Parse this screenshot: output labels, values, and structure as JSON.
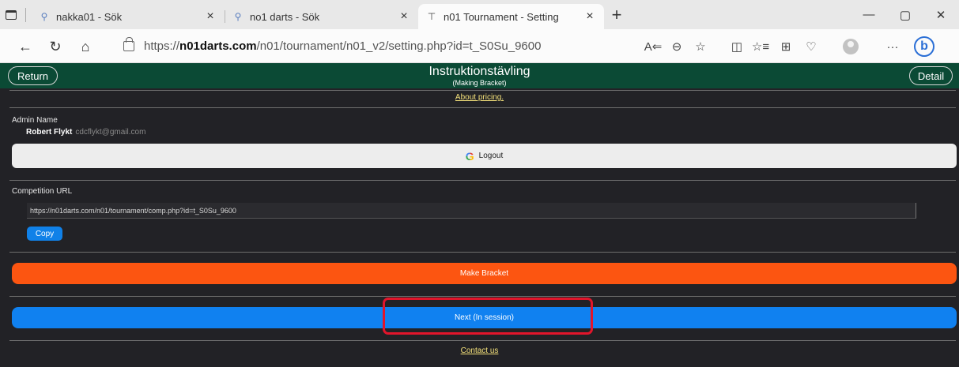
{
  "browser": {
    "tabs": [
      {
        "title": "nakka01 - Sök",
        "icon": "search-icon"
      },
      {
        "title": "no1 darts - Sök",
        "icon": "search-icon"
      },
      {
        "title": "n01 Tournament - Setting",
        "icon": "bracket-icon"
      }
    ],
    "url_prefix": "https://",
    "url_domain": "n01darts.com",
    "url_path": "/n01/tournament/n01_v2/setting.php?id=t_S0Su_9600"
  },
  "header": {
    "return_label": "Return",
    "title": "Instruktionstävling",
    "subtitle": "(Making Bracket)",
    "detail_label": "Detail"
  },
  "pricing_link": "About pricing.",
  "admin": {
    "label": "Admin Name",
    "name": "Robert Flykt",
    "email": "cdcflykt@gmail.com",
    "logout_label": "Logout"
  },
  "competition": {
    "label": "Competition URL",
    "url": "https://n01darts.com/n01/tournament/comp.php?id=t_S0Su_9600",
    "copy_label": "Copy"
  },
  "make_bracket_label": "Make Bracket",
  "next_label": "Next (In session)",
  "contact_label": "Contact us",
  "colors": {
    "header_bg": "#0b4a35",
    "page_bg": "#222226",
    "make_bracket": "#fc5511",
    "next": "#1081f0",
    "link": "#f3e07a",
    "annotation": "#e2152b"
  }
}
